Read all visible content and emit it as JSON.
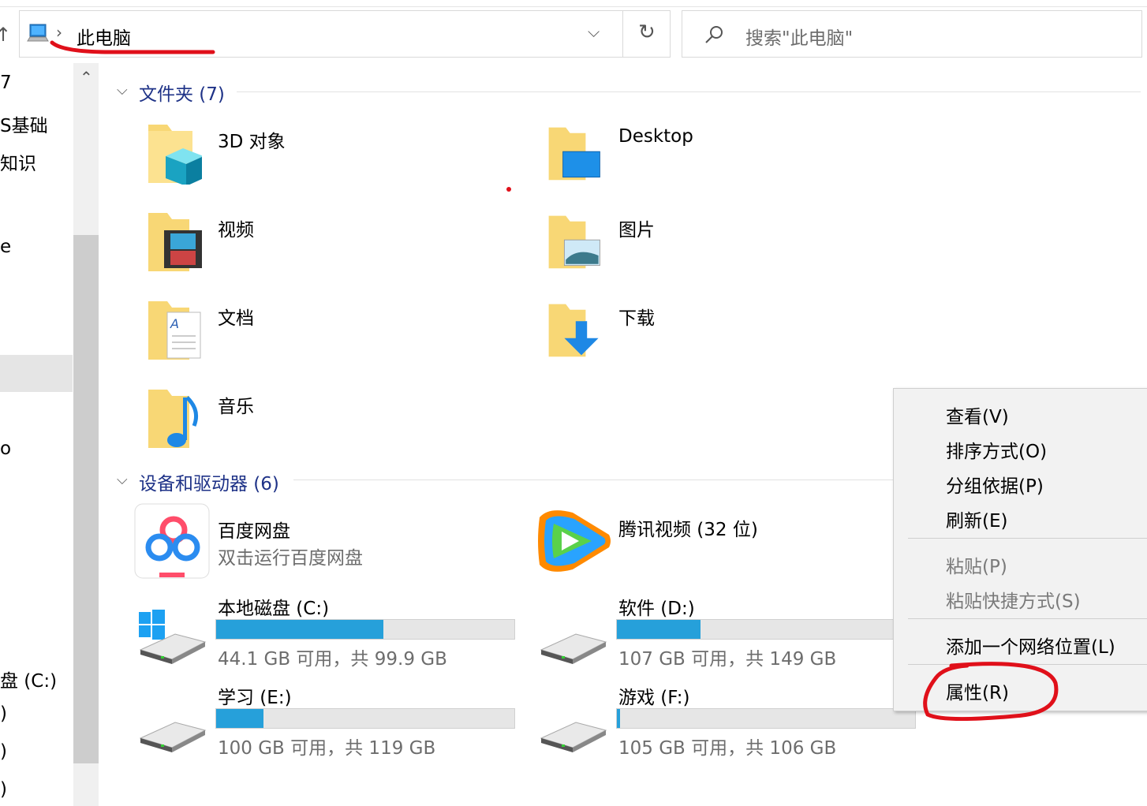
{
  "address": {
    "location": "此电脑",
    "search_placeholder": "搜索\"此电脑\""
  },
  "nav": {
    "items": [
      "7",
      "S基础",
      "知识",
      "e",
      "",
      "o",
      "盘 (C:)",
      ")",
      ")",
      ")"
    ]
  },
  "folders_group": {
    "title": "文件夹 (7)",
    "items": [
      {
        "label": "3D 对象",
        "icon": "3d-objects-folder-icon"
      },
      {
        "label": "Desktop",
        "icon": "desktop-folder-icon"
      },
      {
        "label": "视频",
        "icon": "videos-folder-icon"
      },
      {
        "label": "图片",
        "icon": "pictures-folder-icon"
      },
      {
        "label": "文档",
        "icon": "documents-folder-icon"
      },
      {
        "label": "下载",
        "icon": "downloads-folder-icon"
      },
      {
        "label": "音乐",
        "icon": "music-folder-icon"
      }
    ]
  },
  "devices_group": {
    "title": "设备和驱动器 (6)",
    "apps": [
      {
        "label": "百度网盘",
        "sub": "双击运行百度网盘",
        "icon": "baidu-netdisk-icon"
      },
      {
        "label": "腾讯视频 (32 位)",
        "icon": "tencent-video-icon"
      }
    ],
    "drives": [
      {
        "label": "本地磁盘 (C:)",
        "free": "44.1 GB 可用，共 99.9 GB",
        "used_fraction": 0.56
      },
      {
        "label": "软件 (D:)",
        "free": "107 GB 可用，共 149 GB",
        "used_fraction": 0.28
      },
      {
        "label": "学习 (E:)",
        "free": "100 GB 可用，共 119 GB",
        "used_fraction": 0.16
      },
      {
        "label": "游戏 (F:)",
        "free": "105 GB 可用，共 106 GB",
        "used_fraction": 0.01
      }
    ]
  },
  "context_menu": {
    "view": "查看(V)",
    "sort": "排序方式(O)",
    "group": "分组依据(P)",
    "refresh": "刷新(E)",
    "paste": "粘贴(P)",
    "paste_shortcut": "粘贴快捷方式(S)",
    "add_network": "添加一个网络位置(L)",
    "properties": "属性(R)"
  },
  "colors": {
    "accent": "#26a0da",
    "group_header": "#1e3287",
    "annotation_red": "#e0101a",
    "folder_yellow": "#f8d775"
  }
}
